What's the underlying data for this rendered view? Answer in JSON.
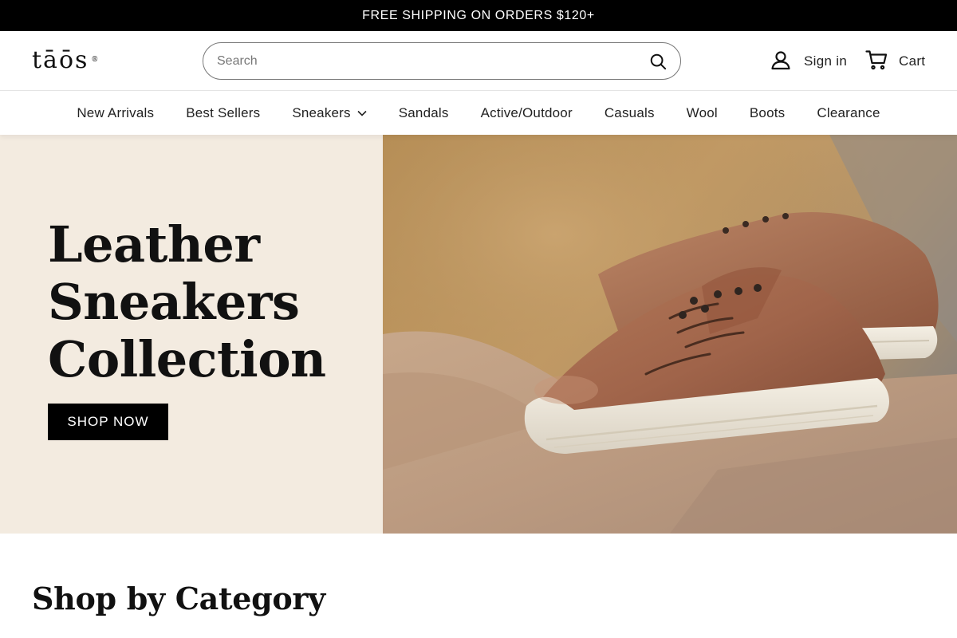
{
  "announcement": {
    "text": "FREE SHIPPING ON ORDERS $120+"
  },
  "header": {
    "logo": {
      "text": "tāōs",
      "mark": "®"
    },
    "search": {
      "placeholder": "Search",
      "value": "",
      "icon": "search-icon"
    },
    "account": {
      "label": "Sign in",
      "icon": "user-icon"
    },
    "cart": {
      "label": "Cart",
      "icon": "cart-icon"
    }
  },
  "nav": {
    "items": [
      {
        "label": "New Arrivals"
      },
      {
        "label": "Best Sellers"
      },
      {
        "label": "Sneakers",
        "dropdown": true,
        "icon": "chevron-down-icon"
      },
      {
        "label": "Sandals"
      },
      {
        "label": "Active/Outdoor"
      },
      {
        "label": "Casuals"
      },
      {
        "label": "Wool"
      },
      {
        "label": "Boots"
      },
      {
        "label": "Clearance"
      }
    ]
  },
  "hero": {
    "title_lines": [
      "Leather",
      "Sneakers",
      "Collection"
    ],
    "cta_label": "SHOP NOW",
    "image": "leather-sneakers-on-rock-photo"
  },
  "sections": {
    "category_title": "Shop by Category"
  },
  "colors": {
    "announcement_bg": "#000000",
    "hero_panel_bg": "#f3ebe0",
    "cta_bg": "#000000",
    "text": "#111111"
  }
}
